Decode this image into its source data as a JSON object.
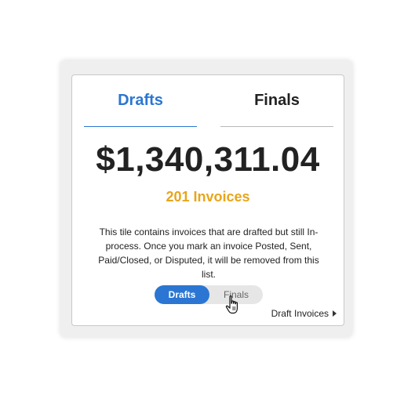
{
  "tabs": {
    "drafts_label": "Drafts",
    "finals_label": "Finals",
    "active": "Drafts"
  },
  "summary": {
    "amount": "$1,340,311.04",
    "invoice_count": "201 Invoices",
    "description": "This tile contains invoices that are drafted but still In-process. Once you mark an invoice Posted, Sent, Paid/Closed, or Disputed, it will be removed from this list."
  },
  "toggle": {
    "drafts_label": "Drafts",
    "finals_label": "Finals",
    "selected": "Drafts"
  },
  "link": {
    "label": "Draft Invoices",
    "icon": "caret-right-icon"
  },
  "cursor": {
    "icon": "hand-pointer-icon"
  },
  "colors": {
    "accent": "#2b76d2",
    "count": "#e8a51b",
    "text": "#222222"
  }
}
